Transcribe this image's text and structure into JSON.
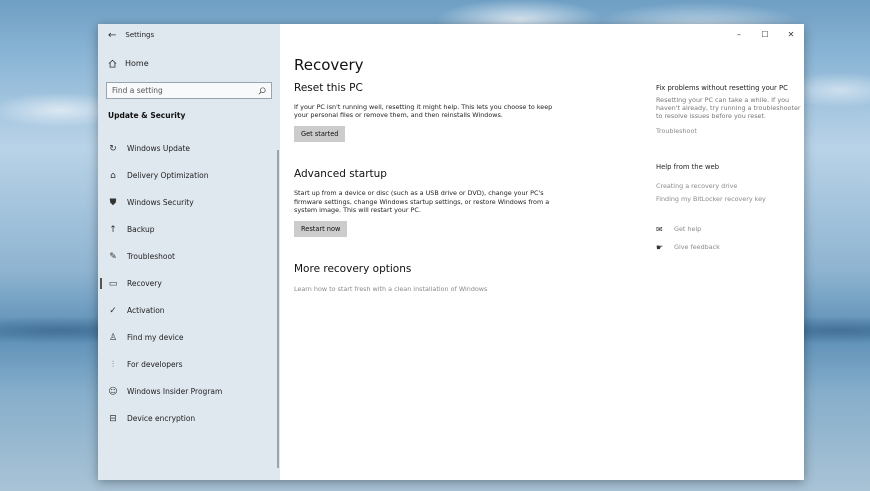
{
  "window": {
    "title": "Settings",
    "controls": [
      "–",
      "☐",
      "✕"
    ]
  },
  "sidebar": {
    "home_label": "Home",
    "search_placeholder": "Find a setting",
    "section_title": "Update & Security",
    "items": [
      {
        "label": "Windows Update",
        "icon": "refresh-icon"
      },
      {
        "label": "Delivery Optimization",
        "icon": "delivery-icon"
      },
      {
        "label": "Windows Security",
        "icon": "shield-icon"
      },
      {
        "label": "Backup",
        "icon": "backup-arrow-icon"
      },
      {
        "label": "Troubleshoot",
        "icon": "wrench-icon"
      },
      {
        "label": "Recovery",
        "icon": "recovery-icon"
      },
      {
        "label": "Activation",
        "icon": "check-circle-icon"
      },
      {
        "label": "Find my device",
        "icon": "person-icon"
      },
      {
        "label": "For developers",
        "icon": "developer-icon"
      },
      {
        "label": "Windows Insider Program",
        "icon": "insider-icon"
      },
      {
        "label": "Device encryption",
        "icon": "lock-icon"
      }
    ]
  },
  "main": {
    "title": "Recovery",
    "reset": {
      "heading": "Reset this PC",
      "description": "If your PC isn't running well, resetting it might help. This lets you choose to keep your personal files or remove them, and then reinstalls Windows.",
      "button": "Get started"
    },
    "advanced": {
      "heading": "Advanced startup",
      "description": "Start up from a device or disc (such as a USB drive or DVD), change your PC's firmware settings, change Windows startup settings, or restore Windows from a system image. This will restart your PC.",
      "button": "Restart now"
    },
    "more": {
      "heading": "More recovery options",
      "link": "Learn how to start fresh with a clean installation of Windows"
    }
  },
  "side_panel": {
    "fix_title": "Fix problems without resetting your PC",
    "fix_text": "Resetting your PC can take a while. If you haven't already, try running a troubleshooter to resolve issues before you reset.",
    "fix_link": "Troubleshoot",
    "web_title": "Help from the web",
    "web_links": [
      "Creating a recovery drive",
      "Finding my BitLocker recovery key"
    ],
    "get_help": "Get help",
    "give_feedback": "Give feedback"
  }
}
